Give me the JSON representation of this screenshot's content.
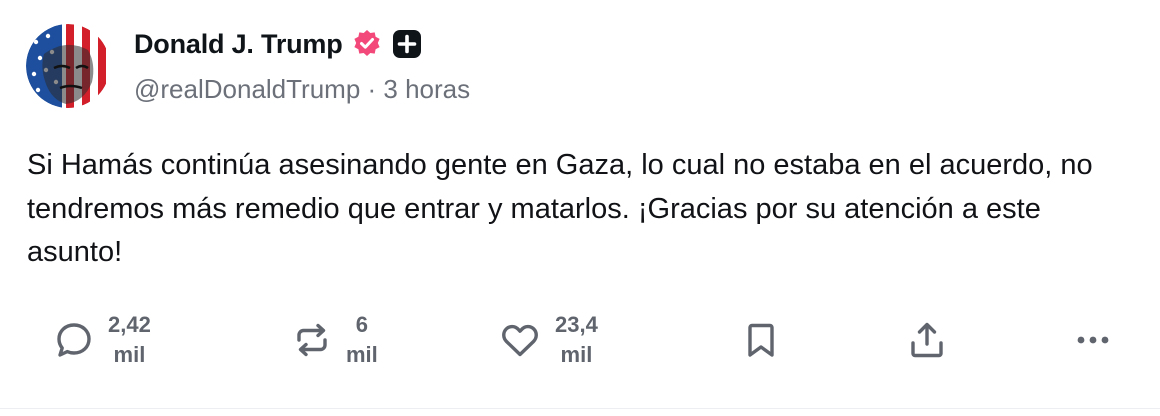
{
  "post": {
    "author": {
      "display_name": "Donald J. Trump",
      "handle": "@realDonaldTrump",
      "separator": " · ",
      "time_ago": "3 horas",
      "verified_icon": "verified-badge-icon",
      "extra_icon": "plus-badge-icon",
      "avatar": "avatar-image"
    },
    "text": "Si Hamás continúa asesinando gente en Gaza, lo cual no estaba en el acuerdo, no tendremos más remedio que entrar y matarlos. ¡Gracias por su atención a este asunto!",
    "actions": {
      "reply": {
        "icon": "reply-icon",
        "count_line1": "2,42",
        "count_line2": "mil"
      },
      "repost": {
        "icon": "repost-icon",
        "count_line1": "6",
        "count_line2": "mil"
      },
      "like": {
        "icon": "heart-icon",
        "count_line1": "23,4",
        "count_line2": "mil"
      },
      "bookmark": {
        "icon": "bookmark-icon"
      },
      "share": {
        "icon": "share-icon"
      },
      "more": {
        "icon": "more-icon"
      }
    }
  },
  "colors": {
    "text": "#0f1419",
    "secondary": "#6b7079",
    "icon": "#5f646d",
    "verified": "#f2487a"
  }
}
